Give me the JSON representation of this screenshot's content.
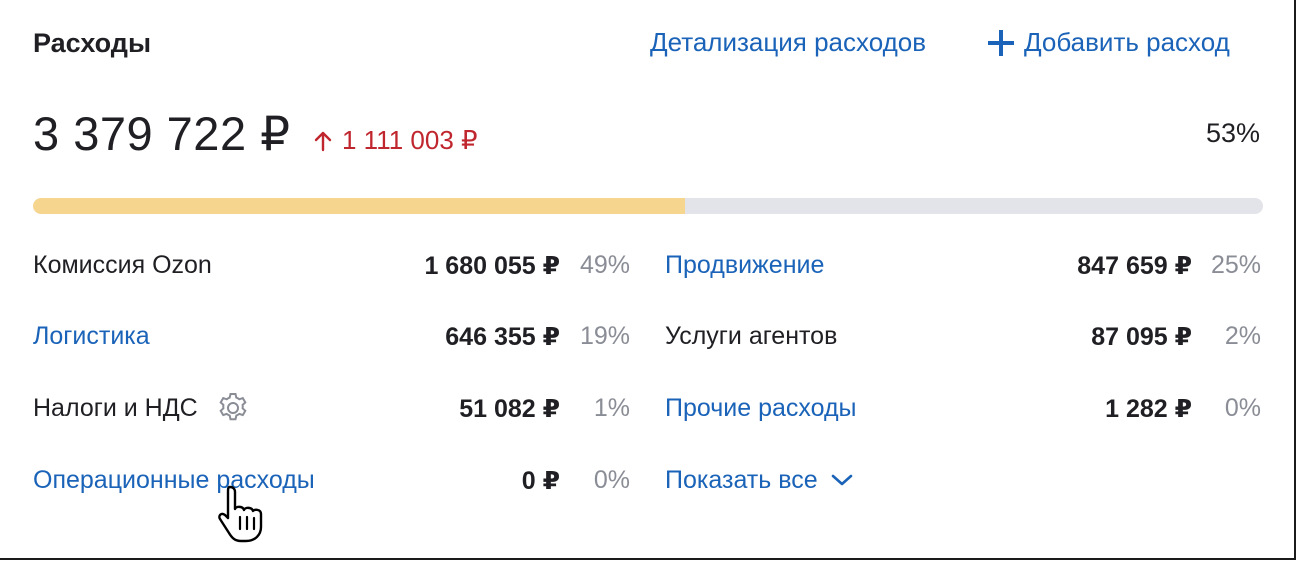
{
  "header": {
    "title": "Расходы",
    "details_link": "Детализация расходов",
    "add_link": "Добавить расход"
  },
  "summary": {
    "total": "3 379 722 ₽",
    "delta": "1 111 003 ₽",
    "delta_direction": "up",
    "percent": "53%",
    "progress_fraction": 0.53
  },
  "left_items": [
    {
      "label": "Комиссия Ozon",
      "value": "1 680 055 ₽",
      "percent": "49%",
      "is_link": false
    },
    {
      "label": "Логистика",
      "value": "646 355 ₽",
      "percent": "19%",
      "is_link": true
    },
    {
      "label": "Налоги и НДС",
      "value": "51 082 ₽",
      "percent": "1%",
      "is_link": false,
      "icon": "gear-icon"
    },
    {
      "label": "Операционные расходы",
      "value": "0 ₽",
      "percent": "0%",
      "is_link": true
    }
  ],
  "right_items": [
    {
      "label": "Продвижение",
      "value": "847 659 ₽",
      "percent": "25%",
      "is_link": true
    },
    {
      "label": "Услуги агентов",
      "value": "87 095 ₽",
      "percent": "2%",
      "is_link": false
    },
    {
      "label": "Прочие расходы",
      "value": "1 282 ₽",
      "percent": "0%",
      "is_link": true
    }
  ],
  "show_all": {
    "label": "Показать все",
    "icon": "chevron-down-icon"
  },
  "colors": {
    "link": "#1a63b8",
    "delta_up": "#c0262e",
    "progress_fill": "#f6d68f",
    "progress_track": "#e3e4e9",
    "percent_text": "#8a8d96"
  },
  "cursor_icon": "hand-pointer-icon"
}
